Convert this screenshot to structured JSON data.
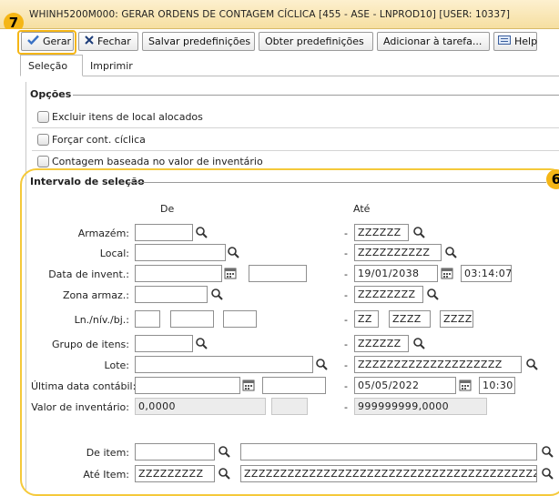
{
  "window": {
    "title": "WHINH5200M000: GERAR ORDENS DE CONTAGEM CÍCLICA [455 - ASE  - LNPROD10] [USER: 10337]"
  },
  "callouts": {
    "toolbar": "7",
    "range": "6"
  },
  "toolbar": {
    "gerar": "Gerar",
    "fechar": "Fechar",
    "salvar": "Salvar predefinições",
    "obter": "Obter predefinições",
    "adicionar": "Adicionar à tarefa...",
    "help": "Help"
  },
  "tabs": {
    "selecao": "Seleção",
    "imprimir": "Imprimir"
  },
  "options": {
    "title": "Opções",
    "items": [
      "Excluir itens de local alocados",
      "Forçar cont. cíclica",
      "Contagem baseada no valor de inventário"
    ]
  },
  "range": {
    "title": "Intervalo de seleção",
    "col_from": "De",
    "col_to": "Até",
    "dash": "-",
    "armazem": {
      "label": "Armazém:",
      "from": "",
      "to": "ZZZZZZ"
    },
    "local": {
      "label": "Local:",
      "from": "",
      "to": "ZZZZZZZZZZ"
    },
    "data_invent": {
      "label": "Data de invent.:",
      "from_date": "",
      "from_time": "",
      "to_date": "19/01/2038",
      "to_time": "03:14:07"
    },
    "zona": {
      "label": "Zona armaz.:",
      "from": "",
      "to": "ZZZZZZZZ"
    },
    "ln": {
      "label": "Ln./nív./bj.:",
      "from1": "",
      "from2": "",
      "from3": "",
      "to1": "ZZ",
      "to2": "ZZZZ",
      "to3": "ZZZZ"
    },
    "grupo": {
      "label": "Grupo de itens:",
      "from": "",
      "to": "ZZZZZZ"
    },
    "lote": {
      "label": "Lote:",
      "from": "",
      "to": "ZZZZZZZZZZZZZZZZZZZZ"
    },
    "ultima_data": {
      "label": "Última data contábil:",
      "from_date": "",
      "from_time": "",
      "to_date": "05/05/2022",
      "to_time": "10:30"
    },
    "valor": {
      "label": "Valor de inventário:",
      "from": "0,0000",
      "from2": "",
      "to": "999999999,0000"
    },
    "de_item": {
      "label": "De item:",
      "project": "",
      "item": ""
    },
    "ate_item": {
      "label": "Até Item:",
      "project": "ZZZZZZZZZ",
      "item": "ZZZZZZZZZZZZZZZZZZZZZZZZZZZZZZZZZZZZZZZZZZ"
    }
  },
  "colors": {
    "accent": "#f5b616",
    "titlebar": "#f6dfa1"
  },
  "icons": [
    "check-icon",
    "close-icon",
    "help-icon",
    "zoom-icon",
    "calendar-icon"
  ]
}
